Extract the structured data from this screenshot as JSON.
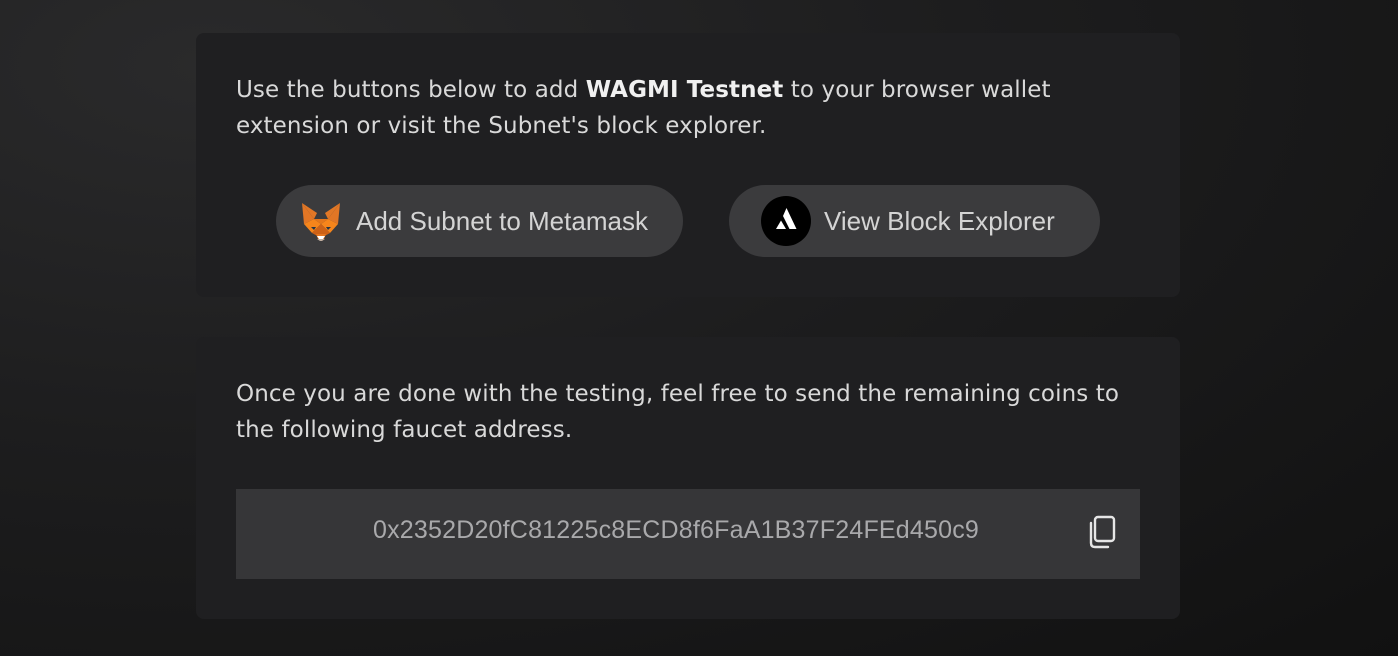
{
  "wallet_card": {
    "intro_prefix": "Use the buttons below to add ",
    "network_name": "WAGMI Testnet",
    "intro_suffix": " to your browser wallet extension or visit the Subnet's block explorer.",
    "metamask_button": {
      "label": "Add Subnet to Metamask",
      "icon": "metamask-fox-icon"
    },
    "explorer_button": {
      "label": "View Block Explorer",
      "icon": "avalanche-logo-icon"
    }
  },
  "faucet_card": {
    "message": "Once you are done with the testing, feel free to send the remaining coins to the following faucet address.",
    "address": "0x2352D20fC81225c8ECD8f6FaA1B37F24FEd450c9",
    "copy_icon": "copy-icon"
  },
  "colors": {
    "page_background": "#1d1d1e",
    "card_background": "#1f1f21",
    "button_background": "#3b3b3d",
    "address_background": "#363638",
    "avalanche_red_accent": "#000000"
  }
}
